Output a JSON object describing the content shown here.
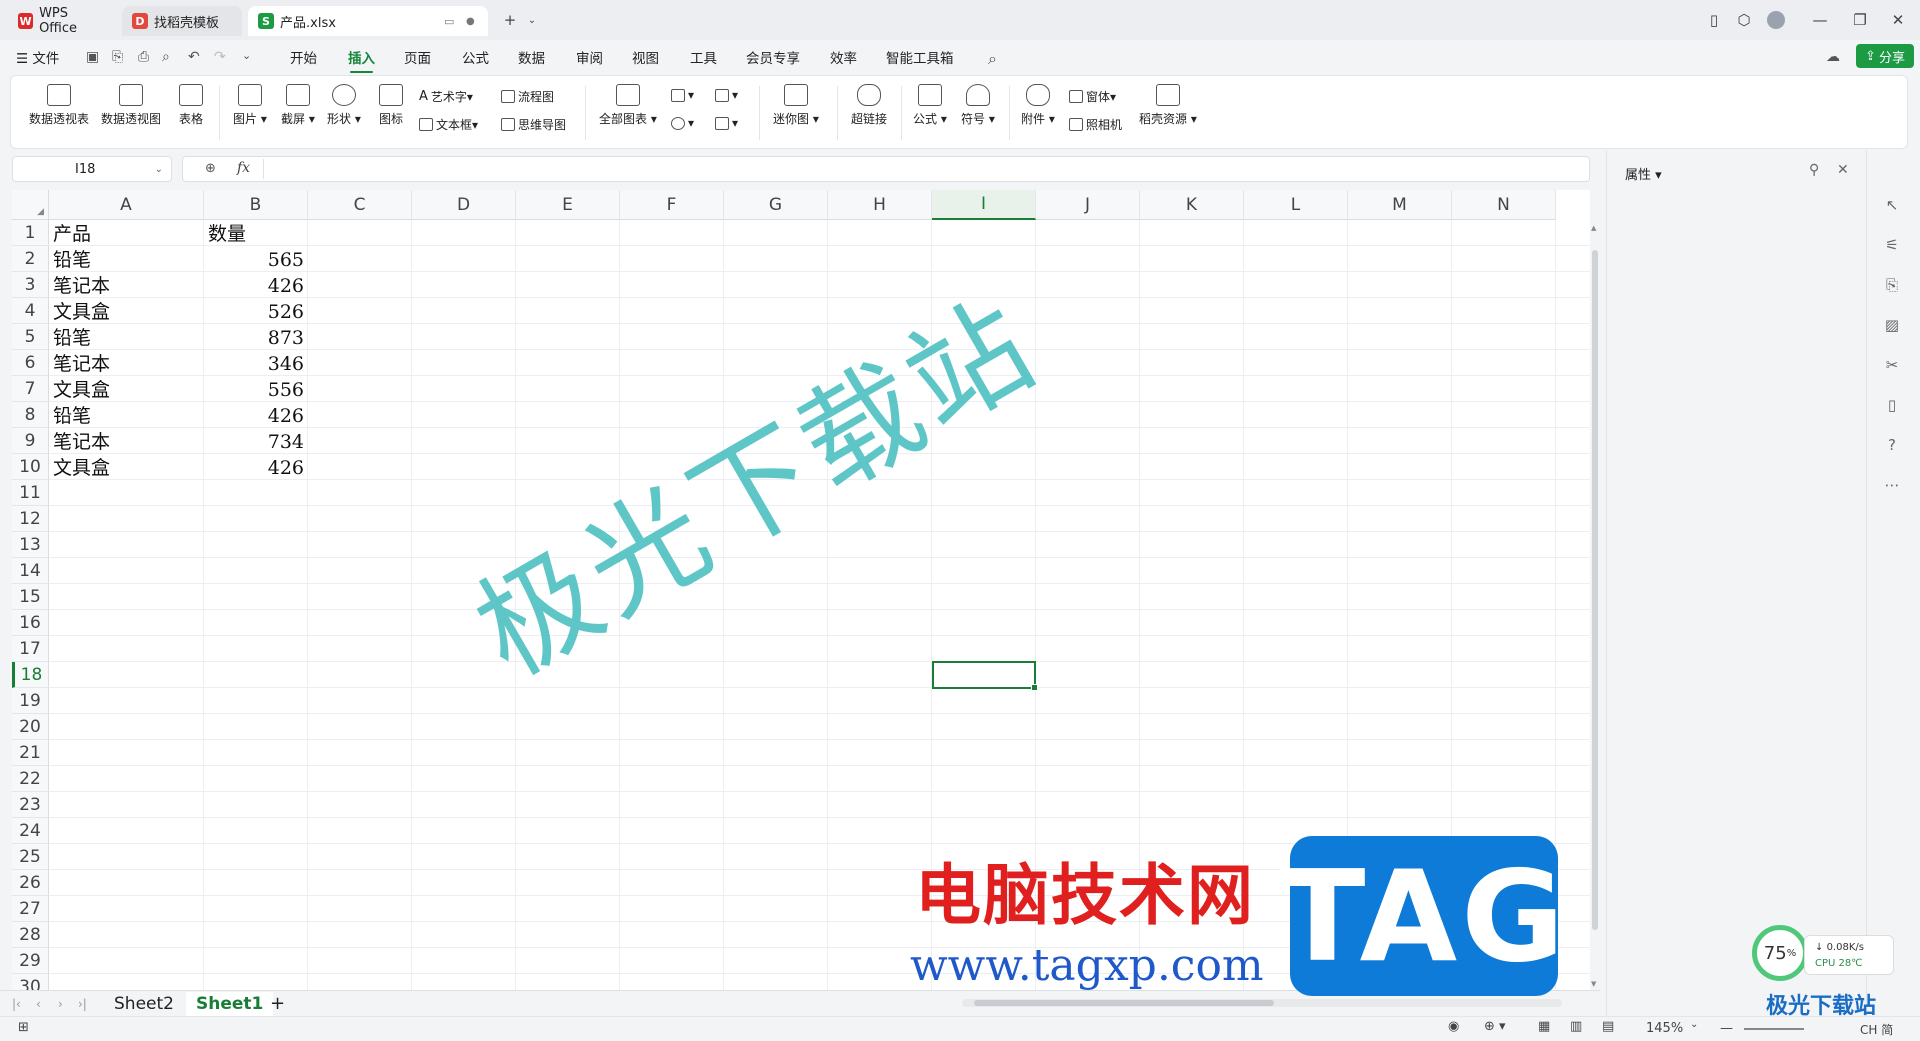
{
  "tabs": [
    {
      "label": "WPS Office",
      "logo": "W",
      "color": "#d92b2b"
    },
    {
      "label": "找稻壳模板",
      "logo": "D",
      "color": "#e0493b"
    },
    {
      "label": "产品.xlsx",
      "logo": "S",
      "color": "#1c9a44"
    }
  ],
  "menu": {
    "file": "文件",
    "items": [
      "开始",
      "插入",
      "页面",
      "公式",
      "数据",
      "审阅",
      "视图",
      "工具",
      "会员专享",
      "效率",
      "智能工具箱"
    ],
    "active": "插入",
    "share": "分享"
  },
  "ribbon": {
    "big": [
      "数据透视表",
      "数据透视图",
      "表格",
      "图片",
      "截屏",
      "形状",
      "图标",
      "全部图表",
      "迷你图",
      "超链接",
      "公式",
      "符号",
      "附件",
      "稻壳资源"
    ],
    "small": [
      "艺术字",
      "流程图",
      "文本框",
      "思维导图",
      "窗体",
      "照相机"
    ]
  },
  "formula_bar": {
    "namebox": "I18",
    "fx": "fx",
    "value": ""
  },
  "columns": [
    "A",
    "B",
    "C",
    "D",
    "E",
    "F",
    "G",
    "H",
    "I",
    "J",
    "K",
    "L",
    "M",
    "N"
  ],
  "selected_column": "I",
  "selected_row": 18,
  "rows": 30,
  "cells": [
    [
      "产品",
      "数量"
    ],
    [
      "铅笔",
      "565"
    ],
    [
      "笔记本",
      "426"
    ],
    [
      "文具盒",
      "526"
    ],
    [
      "铅笔",
      "873"
    ],
    [
      "笔记本",
      "346"
    ],
    [
      "文具盒",
      "556"
    ],
    [
      "铅笔",
      "426"
    ],
    [
      "笔记本",
      "734"
    ],
    [
      "文具盒",
      "426"
    ]
  ],
  "sheets": {
    "items": [
      "Sheet2",
      "Sheet1"
    ],
    "active": "Sheet1",
    "add": "+"
  },
  "properties_pane": {
    "title": "属性"
  },
  "status": {
    "zoom": "145%",
    "ime": "CH",
    "ime2": "简"
  },
  "perf": {
    "percent": "75",
    "percent_sign": "%",
    "speed": "0.08K/s",
    "cpu": "CPU 28℃"
  },
  "watermarks": {
    "main": "极光下载站",
    "red": "电脑技术网",
    "url": "www.tagxp.com",
    "tag": "TAG",
    "corner": "极光下载站"
  }
}
